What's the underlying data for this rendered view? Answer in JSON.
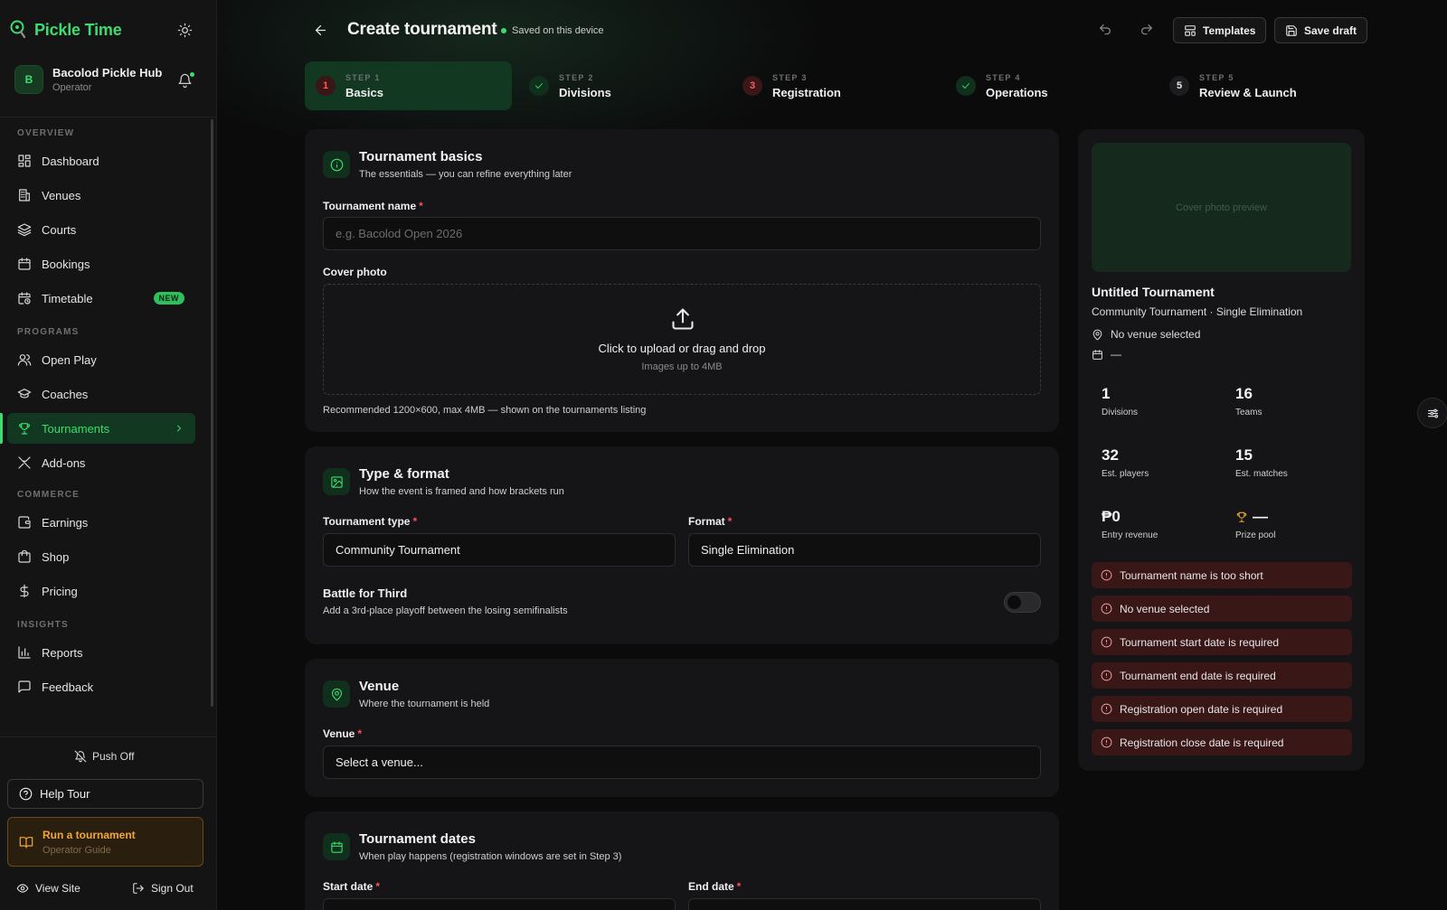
{
  "app": {
    "brand": "Pickle Time",
    "org_name": "Bacolod Pickle Hub",
    "org_role": "Operator",
    "org_initial": "B"
  },
  "sidebar": {
    "sections": {
      "overview": "OVERVIEW",
      "programs": "PROGRAMS",
      "commerce": "COMMERCE",
      "insights": "INSIGHTS"
    },
    "items": {
      "dashboard": "Dashboard",
      "venues": "Venues",
      "courts": "Courts",
      "bookings": "Bookings",
      "timetable": "Timetable",
      "timetable_badge": "NEW",
      "open_play": "Open Play",
      "coaches": "Coaches",
      "tournaments": "Tournaments",
      "addons": "Add-ons",
      "earnings": "Earnings",
      "shop": "Shop",
      "pricing": "Pricing",
      "reports": "Reports",
      "feedback": "Feedback"
    },
    "bottom": {
      "push": "Push Off",
      "help": "Help Tour",
      "guide_title": "Run a tournament",
      "guide_sub": "Operator Guide",
      "view_site": "View Site",
      "sign_out": "Sign Out"
    }
  },
  "header": {
    "title": "Create tournament",
    "saved": "Saved on this device",
    "templates": "Templates",
    "save_draft": "Save draft"
  },
  "steps": [
    {
      "kicker": "STEP 1",
      "label": "Basics",
      "badge": "1",
      "state": "error"
    },
    {
      "kicker": "STEP 2",
      "label": "Divisions",
      "badge": "check",
      "state": "done"
    },
    {
      "kicker": "STEP 3",
      "label": "Registration",
      "badge": "3",
      "state": "error"
    },
    {
      "kicker": "STEP 4",
      "label": "Operations",
      "badge": "check",
      "state": "done"
    },
    {
      "kicker": "STEP 5",
      "label": "Review & Launch",
      "badge": "5",
      "state": "pending"
    }
  ],
  "basics": {
    "title": "Tournament basics",
    "subtitle": "The essentials — you can refine everything later",
    "name_label": "Tournament name",
    "name_placeholder": "e.g. Bacolod Open 2026",
    "cover_label": "Cover photo",
    "upload_text": "Click to upload or drag and drop",
    "upload_sub": "Images up to 4MB",
    "cover_hint": "Recommended 1200×600, max 4MB — shown on the tournaments listing"
  },
  "type_format": {
    "title": "Type & format",
    "subtitle": "How the event is framed and how brackets run",
    "type_label": "Tournament type",
    "type_value": "Community Tournament",
    "format_label": "Format",
    "format_value": "Single Elimination",
    "third_title": "Battle for Third",
    "third_sub": "Add a 3rd-place playoff between the losing semifinalists",
    "third_enabled": false
  },
  "venue": {
    "title": "Venue",
    "subtitle": "Where the tournament is held",
    "label": "Venue",
    "placeholder": "Select a venue..."
  },
  "dates": {
    "title": "Tournament dates",
    "subtitle": "When play happens (registration windows are set in Step 3)",
    "start_label": "Start date",
    "end_label": "End date"
  },
  "preview": {
    "cover_text": "Cover photo preview",
    "title": "Untitled Tournament",
    "subtitle": "Community Tournament · Single Elimination",
    "venue": "No venue selected",
    "date": "—",
    "stats": [
      {
        "value": "1",
        "label": "Divisions"
      },
      {
        "value": "16",
        "label": "Teams"
      },
      {
        "value": "32",
        "label": "Est. players"
      },
      {
        "value": "15",
        "label": "Est. matches"
      },
      {
        "value": "₱0",
        "label": "Entry revenue"
      },
      {
        "value": "—",
        "label": "Prize pool"
      }
    ],
    "alerts": [
      "Tournament name is too short",
      "No venue selected",
      "Tournament start date is required",
      "Tournament end date is required",
      "Registration open date is required",
      "Registration close date is required"
    ]
  },
  "colors": {
    "accent": "#3ddc6f",
    "error": "#ff5b5b",
    "warning": "#f0a73c"
  }
}
